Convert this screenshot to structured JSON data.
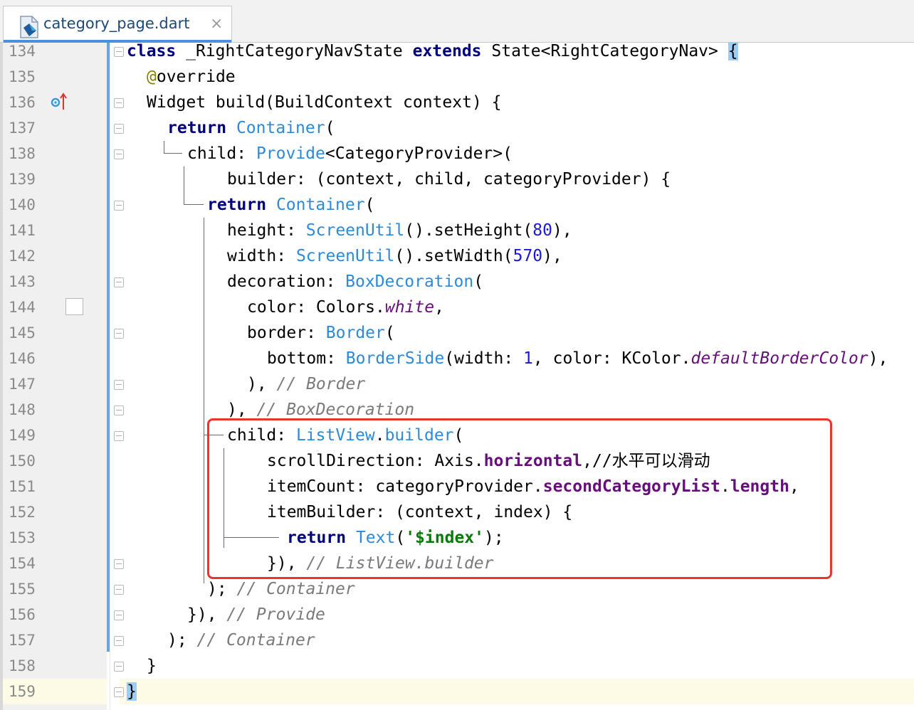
{
  "tab": {
    "label": "category_page.dart",
    "close": "×",
    "file_icon": "dart-file-icon"
  },
  "editor": {
    "current_line": "159",
    "lines": [
      {
        "num": "134"
      },
      {
        "num": "135"
      },
      {
        "num": "136"
      },
      {
        "num": "137"
      },
      {
        "num": "138"
      },
      {
        "num": "139"
      },
      {
        "num": "140"
      },
      {
        "num": "141"
      },
      {
        "num": "142"
      },
      {
        "num": "143"
      },
      {
        "num": "144"
      },
      {
        "num": "145"
      },
      {
        "num": "146"
      },
      {
        "num": "147"
      },
      {
        "num": "148"
      },
      {
        "num": "149"
      },
      {
        "num": "150"
      },
      {
        "num": "151"
      },
      {
        "num": "152"
      },
      {
        "num": "153"
      },
      {
        "num": "154"
      },
      {
        "num": "155"
      },
      {
        "num": "156"
      },
      {
        "num": "157"
      },
      {
        "num": "158"
      },
      {
        "num": "159"
      }
    ],
    "code": {
      "l134": {
        "kw1": "class",
        "t1": " _RightCategoryNavState ",
        "kw2": "extends",
        "t2": " State<RightCategoryNav> ",
        "brace": "{"
      },
      "l135": {
        "at": "@",
        "t1": "override"
      },
      "l136": {
        "t1": "Widget build(BuildContext context) {"
      },
      "l137": {
        "kw1": "return",
        "sp": " ",
        "c1": "Container",
        "t1": "("
      },
      "l138": {
        "t1": "child: ",
        "c1": "Provide",
        "t2": "<CategoryProvider>("
      },
      "l139": {
        "t1": "builder: (context, child, categoryProvider) {"
      },
      "l140": {
        "kw1": "return",
        "sp": " ",
        "c1": "Container",
        "t1": "("
      },
      "l141": {
        "t1": "height: ",
        "c1": "ScreenUtil",
        "t2": "().setHeight(",
        "n1": "80",
        "t3": "),"
      },
      "l142": {
        "t1": "width: ",
        "c1": "ScreenUtil",
        "t2": "().setWidth(",
        "n1": "570",
        "t3": "),"
      },
      "l143": {
        "t1": "decoration: ",
        "c1": "BoxDecoration",
        "t2": "("
      },
      "l144": {
        "t1": "color: Colors.",
        "f1": "white",
        "t2": ","
      },
      "l145": {
        "t1": "border: ",
        "c1": "Border",
        "t2": "("
      },
      "l146": {
        "t1": "bottom: ",
        "c1": "BorderSide",
        "t2": "(width: ",
        "n1": "1",
        "t3": ", color: KColor.",
        "f1": "defaultBorderColor",
        "t4": "),"
      },
      "l147": {
        "t1": "), ",
        "cm": "// Border"
      },
      "l148": {
        "t1": "), ",
        "cm": "// BoxDecoration"
      },
      "l149": {
        "t1": "child: ",
        "c1": "ListView",
        "t2": ".",
        "c2": "builder",
        "t3": "("
      },
      "l150": {
        "t1": "scrollDirection: Axis.",
        "f1": "horizontal",
        "t2": ",//水平可以滑动"
      },
      "l151": {
        "t1": "itemCount: categoryProvider.",
        "f1": "secondCategoryList",
        "t2": ".",
        "f2": "length",
        "t3": ","
      },
      "l152": {
        "t1": "itemBuilder: (context, index) {"
      },
      "l153": {
        "kw1": "return",
        "sp": " ",
        "c1": "Text",
        "t1": "(",
        "s1": "'$index'",
        "t2": ");"
      },
      "l154": {
        "t1": "}), ",
        "cm": "// ListView.builder"
      },
      "l155": {
        "t1": "); ",
        "cm": "// Container"
      },
      "l156": {
        "t1": "}), ",
        "cm": "// Provide"
      },
      "l157": {
        "t1": "); ",
        "cm": "// Container"
      },
      "l158": {
        "t1": "}"
      },
      "l159": {
        "brace": "}"
      }
    }
  },
  "colors": {
    "keyword": "#000080",
    "class_ref": "#2b8adb",
    "number": "#1a1ad0",
    "comment": "#7a7a7a",
    "field": "#660e7a",
    "string": "#0a7a0a",
    "highlight_box": "#e8362b",
    "current_line": "#fdfbe5"
  }
}
